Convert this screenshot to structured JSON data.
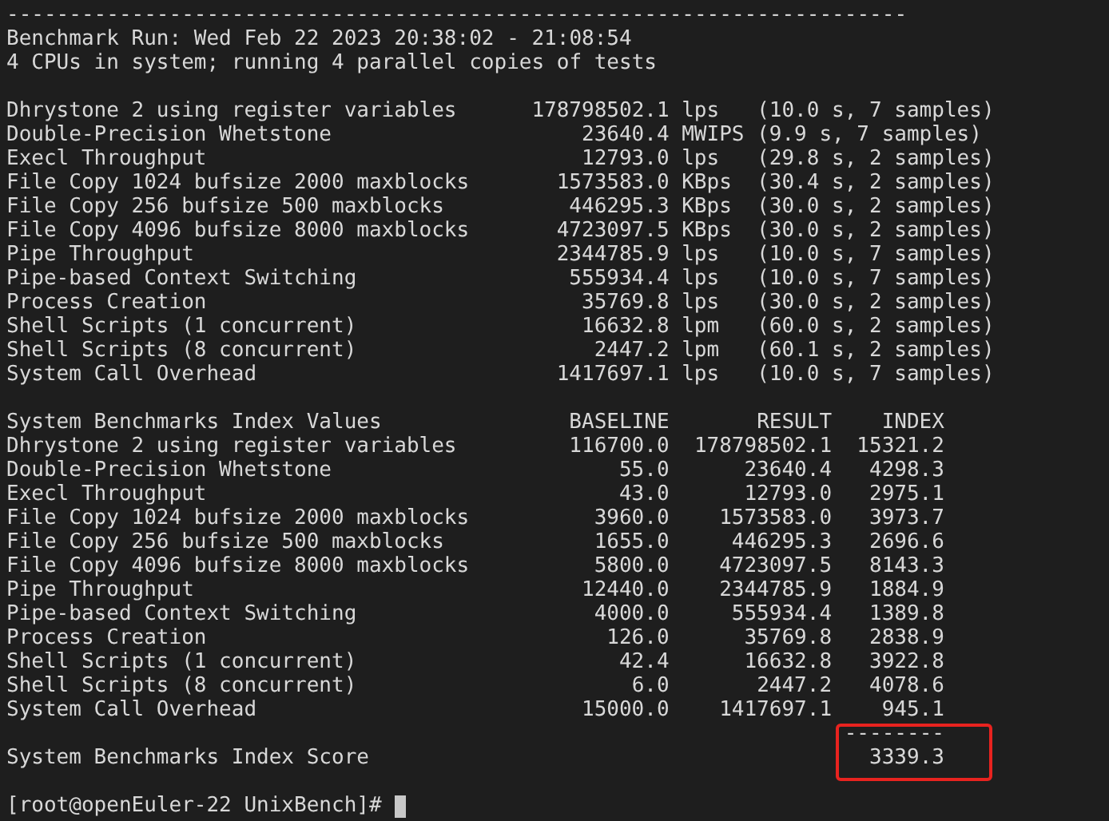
{
  "separator": "------------------------------------------------------------------------",
  "header": [
    "Benchmark Run: Wed Feb 22 2023 20:38:02 - 21:08:54",
    "4 CPUs in system; running 4 parallel copies of tests"
  ],
  "tests": [
    {
      "name": "Dhrystone 2 using register variables",
      "value": "178798502.1",
      "unit": "lps",
      "samples": "(10.0 s, 7 samples)"
    },
    {
      "name": "Double-Precision Whetstone",
      "value": "23640.4",
      "unit": "MWIPS",
      "samples": "(9.9 s, 7 samples)"
    },
    {
      "name": "Execl Throughput",
      "value": "12793.0",
      "unit": "lps",
      "samples": "(29.8 s, 2 samples)"
    },
    {
      "name": "File Copy 1024 bufsize 2000 maxblocks",
      "value": "1573583.0",
      "unit": "KBps",
      "samples": "(30.4 s, 2 samples)"
    },
    {
      "name": "File Copy 256 bufsize 500 maxblocks",
      "value": "446295.3",
      "unit": "KBps",
      "samples": "(30.0 s, 2 samples)"
    },
    {
      "name": "File Copy 4096 bufsize 8000 maxblocks",
      "value": "4723097.5",
      "unit": "KBps",
      "samples": "(30.0 s, 2 samples)"
    },
    {
      "name": "Pipe Throughput",
      "value": "2344785.9",
      "unit": "lps",
      "samples": "(10.0 s, 7 samples)"
    },
    {
      "name": "Pipe-based Context Switching",
      "value": "555934.4",
      "unit": "lps",
      "samples": "(10.0 s, 7 samples)"
    },
    {
      "name": "Process Creation",
      "value": "35769.8",
      "unit": "lps",
      "samples": "(30.0 s, 2 samples)"
    },
    {
      "name": "Shell Scripts (1 concurrent)",
      "value": "16632.8",
      "unit": "lpm",
      "samples": "(60.0 s, 2 samples)"
    },
    {
      "name": "Shell Scripts (8 concurrent)",
      "value": "2447.2",
      "unit": "lpm",
      "samples": "(60.1 s, 2 samples)"
    },
    {
      "name": "System Call Overhead",
      "value": "1417697.1",
      "unit": "lps",
      "samples": "(10.0 s, 7 samples)"
    }
  ],
  "index_table": {
    "columns": [
      "System Benchmarks Index Values",
      "BASELINE",
      "RESULT",
      "INDEX"
    ],
    "rows": [
      [
        "Dhrystone 2 using register variables",
        "116700.0",
        "178798502.1",
        "15321.2"
      ],
      [
        "Double-Precision Whetstone",
        "55.0",
        "23640.4",
        "4298.3"
      ],
      [
        "Execl Throughput",
        "43.0",
        "12793.0",
        "2975.1"
      ],
      [
        "File Copy 1024 bufsize 2000 maxblocks",
        "3960.0",
        "1573583.0",
        "3973.7"
      ],
      [
        "File Copy 256 bufsize 500 maxblocks",
        "1655.0",
        "446295.3",
        "2696.6"
      ],
      [
        "File Copy 4096 bufsize 8000 maxblocks",
        "5800.0",
        "4723097.5",
        "8143.3"
      ],
      [
        "Pipe Throughput",
        "12440.0",
        "2344785.9",
        "1884.9"
      ],
      [
        "Pipe-based Context Switching",
        "4000.0",
        "555934.4",
        "1389.8"
      ],
      [
        "Process Creation",
        "126.0",
        "35769.8",
        "2838.9"
      ],
      [
        "Shell Scripts (1 concurrent)",
        "42.4",
        "16632.8",
        "3922.8"
      ],
      [
        "Shell Scripts (8 concurrent)",
        "6.0",
        "2447.2",
        "4078.6"
      ],
      [
        "System Call Overhead",
        "15000.0",
        "1417697.1",
        "945.1"
      ]
    ]
  },
  "score": {
    "rule": "--------",
    "label": "System Benchmarks Index Score",
    "value": "3339.3",
    "highlighted": true
  },
  "prompt": "[root@openEuler-22 UnixBench]#"
}
